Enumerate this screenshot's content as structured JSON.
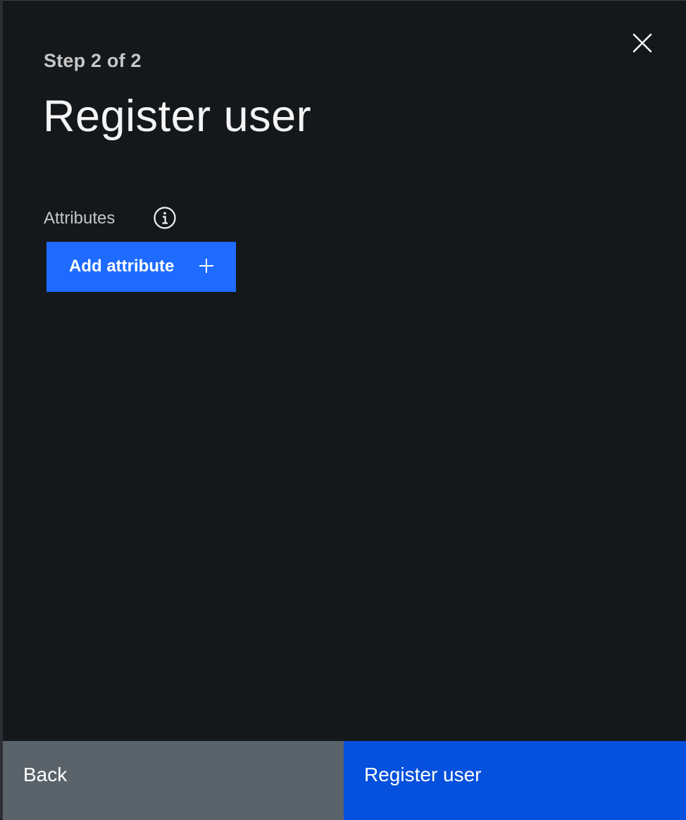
{
  "modal": {
    "step_label": "Step 2 of 2",
    "title": "Register user",
    "close_icon": "close-icon"
  },
  "attributes": {
    "label": "Attributes",
    "info_icon": "information-icon",
    "add_button_label": "Add attribute",
    "add_icon": "plus-icon"
  },
  "footer": {
    "back_label": "Back",
    "submit_label": "Register user"
  },
  "colors": {
    "modal_background": "#15181b",
    "primary_button": "#0550dc",
    "add_button": "#1f6bff",
    "secondary_button": "#5b636a"
  }
}
